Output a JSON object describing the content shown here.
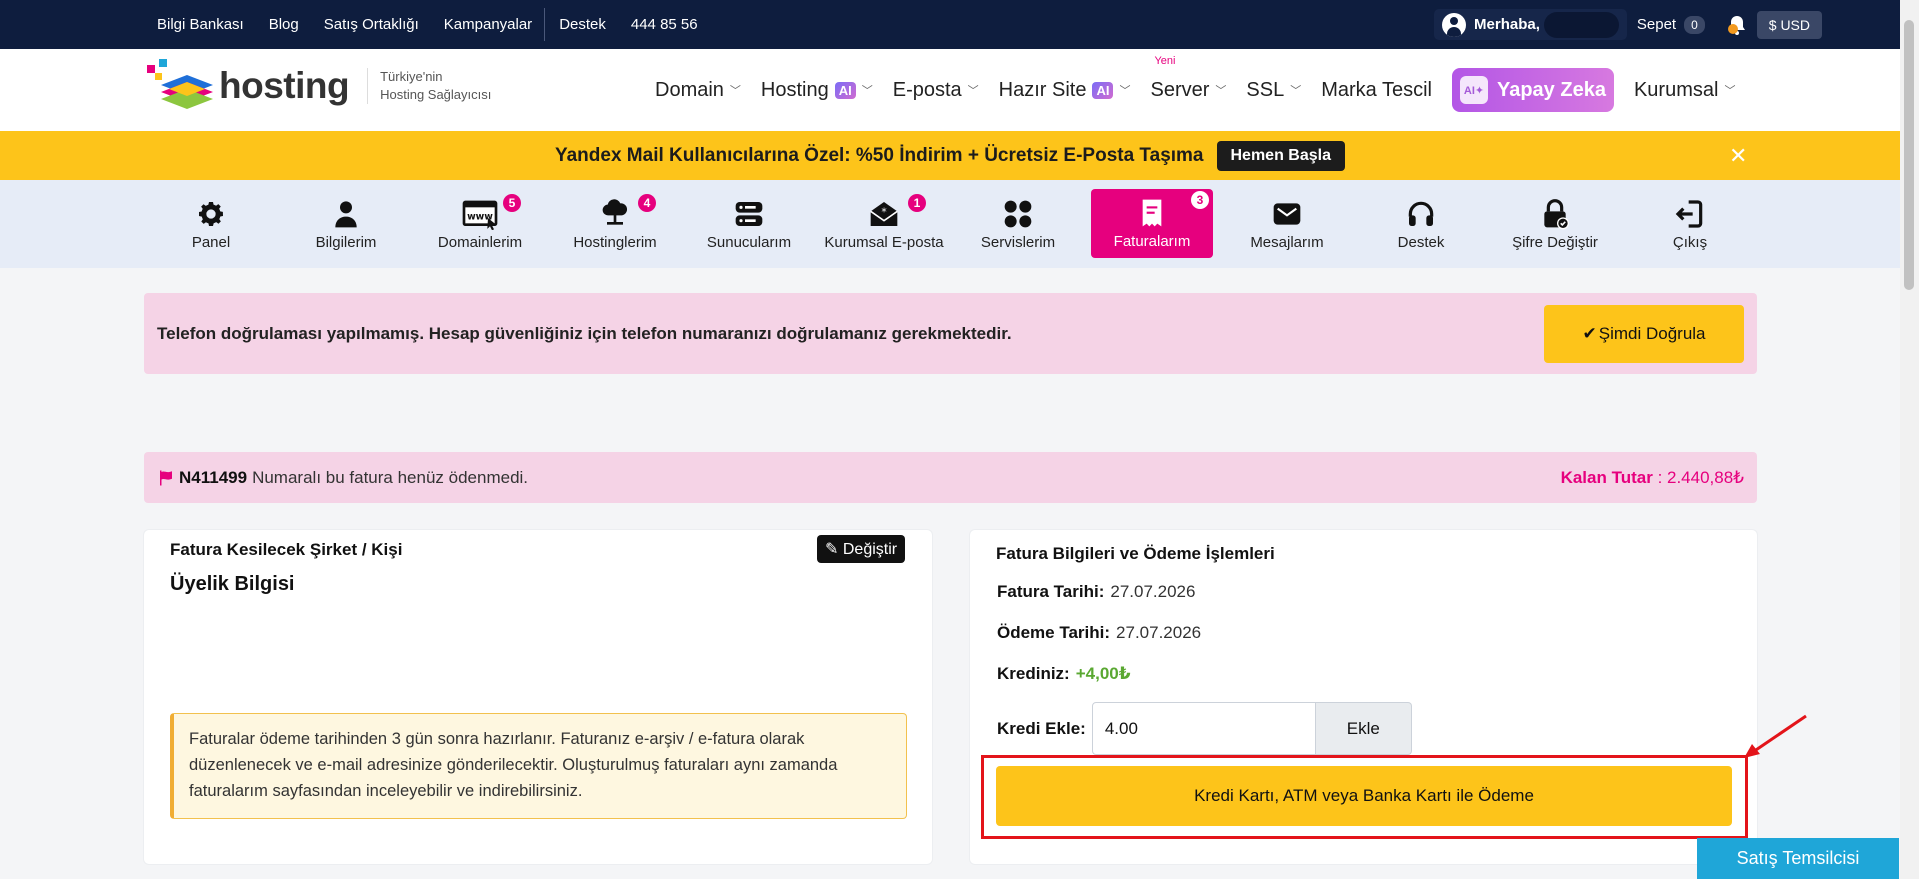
{
  "topbar": {
    "links": [
      "Bilgi Bankası",
      "Blog",
      "Satış Ortaklığı",
      "Kampanyalar"
    ],
    "support": "Destek",
    "phone": "444 85 56",
    "greeting": "Merhaba,",
    "cart_label": "Sepet",
    "cart_count": "0",
    "currency": "$ USD"
  },
  "logo": {
    "word": "hosting",
    "tagline1": "Türkiye'nin",
    "tagline2": "Hosting Sağlayıcısı"
  },
  "nav": {
    "domain": "Domain",
    "hosting": "Hosting",
    "ai": "AI",
    "eposta": "E-posta",
    "hazir_site": "Hazır Site",
    "server": "Server",
    "server_new": "Yeni",
    "ssl": "SSL",
    "marka": "Marka Tescil",
    "yapay_zeka": "Yapay Zeka",
    "kurumsal": "Kurumsal"
  },
  "banner": {
    "text": "Yandex Mail Kullanıcılarına Özel: %50 İndirim + Ücretsiz E-Posta Taşıma",
    "button": "Hemen Başla",
    "close": "✕"
  },
  "iconnav": {
    "items": [
      {
        "label": "Panel"
      },
      {
        "label": "Bilgilerim"
      },
      {
        "label": "Domainlerim",
        "count": "5"
      },
      {
        "label": "Hostinglerim",
        "count": "4"
      },
      {
        "label": "Sunucularım"
      },
      {
        "label": "Kurumsal E-posta",
        "count": "1"
      },
      {
        "label": "Servislerim"
      },
      {
        "label": "Faturalarım",
        "count": "3"
      },
      {
        "label": "Mesajlarım"
      },
      {
        "label": "Destek"
      },
      {
        "label": "Şifre Değiştir"
      },
      {
        "label": "Çıkış"
      }
    ]
  },
  "alert": {
    "text": "Telefon doğrulaması yapılmamış. Hesap güvenliğiniz için telefon numaranızı doğrulamanız gerekmektedir.",
    "button": "Şimdi Doğrula"
  },
  "invoice": {
    "number": "N411499",
    "status_text": "Numaralı bu fatura henüz ödenmedi.",
    "remaining_label": "Kalan Tutar",
    "remaining_value": ": 2.440,88₺"
  },
  "left_card": {
    "title": "Fatura Kesilecek Şirket / Kişi",
    "edit_button": "Değiştir",
    "subtitle": "Üyelik Bilgisi",
    "note": "Faturalar ödeme tarihinden 3 gün sonra hazırlanır. Faturanız e-arşiv / e-fatura olarak düzenlenecek ve e-mail adresinize gönderilecektir. Oluşturulmuş faturaları aynı zamanda faturalarım sayfasından inceleyebilir ve indirebilirsiniz."
  },
  "right_card": {
    "title": "Fatura Bilgileri ve Ödeme İşlemleri",
    "invoice_date_label": "Fatura Tarihi:",
    "invoice_date": "27.07.2026",
    "payment_date_label": "Ödeme Tarihi:",
    "payment_date": "27.07.2026",
    "credit_label": "Krediniz:",
    "credit_value": "+4,00₺",
    "add_credit_label": "Kredi Ekle:",
    "add_credit_value": "4.00",
    "add_button": "Ekle",
    "pay_button": "Kredi Kartı, ATM veya Banka Kartı ile Ödeme"
  },
  "sales_button": "Satış Temsilcisi",
  "colors": {
    "navy": "#0e1d3e",
    "yellow": "#fdc41a",
    "pink": "#e6007e",
    "alert_bg": "#f5d3e6",
    "red_highlight": "#e3141a"
  }
}
